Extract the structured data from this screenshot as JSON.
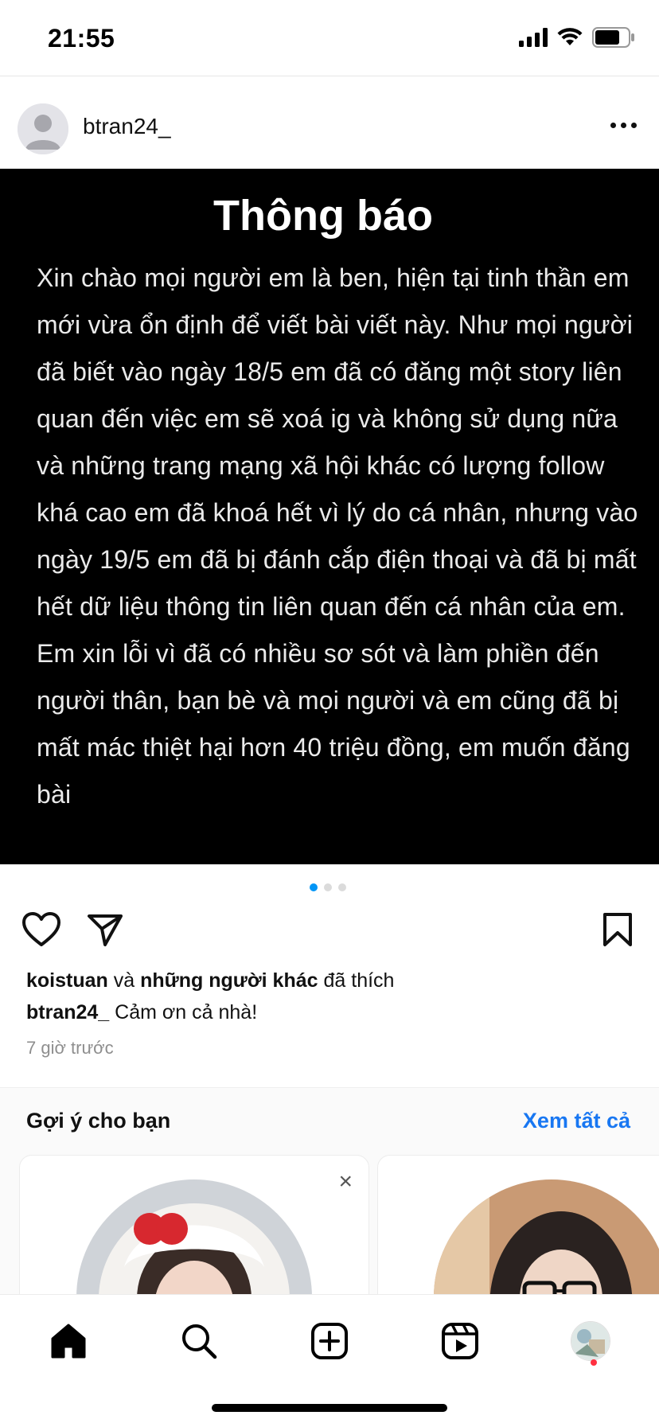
{
  "status_bar": {
    "time": "21:55"
  },
  "post": {
    "username": "btran24_",
    "image": {
      "title": "Thông báo",
      "body": "Xin chào mọi người em là ben, hiện tại tinh thần em mới vừa ổn định để viết bài viết này. Như mọi người đã biết vào ngày 18/5 em đã có đăng một story liên quan đến việc em sẽ xoá ig và không sử dụng nữa và những trang mạng xã hội khác có lượng follow khá cao em đã khoá hết vì lý do cá nhân, nhưng vào ngày 19/5 em đã bị đánh cắp điện thoại và đã bị mất hết dữ liệu thông tin liên quan đến cá nhân của em. Em xin lỗi vì đã có nhiều sơ sót và làm phiền đến người thân, bạn bè và mọi người và em cũng đã bị mất mác thiệt hại hơn 40 triệu đồng, em muốn đăng bài"
    },
    "carousel": {
      "count": 3,
      "active": 1
    },
    "likes": {
      "user": "koistuan",
      "connector": "và",
      "others": "những người khác",
      "suffix": "đã thích"
    },
    "caption": {
      "username": "btran24_",
      "text": "Cảm ơn cả nhà!"
    },
    "time_ago": "7 giờ trước"
  },
  "suggestions": {
    "title": "Gợi ý cho bạn",
    "see_all": "Xem tất cả",
    "close_glyph": "×"
  },
  "colors": {
    "accent": "#1877f2",
    "carousel_active": "#0095f6",
    "notification": "#ff3040"
  },
  "icons": {
    "status": [
      "signal-icon",
      "wifi-icon",
      "battery-icon"
    ],
    "actions": [
      "heart-icon",
      "share-icon",
      "bookmark-icon"
    ],
    "tabs": [
      "home-icon",
      "search-icon",
      "create-icon",
      "reels-icon",
      "profile-icon"
    ]
  }
}
